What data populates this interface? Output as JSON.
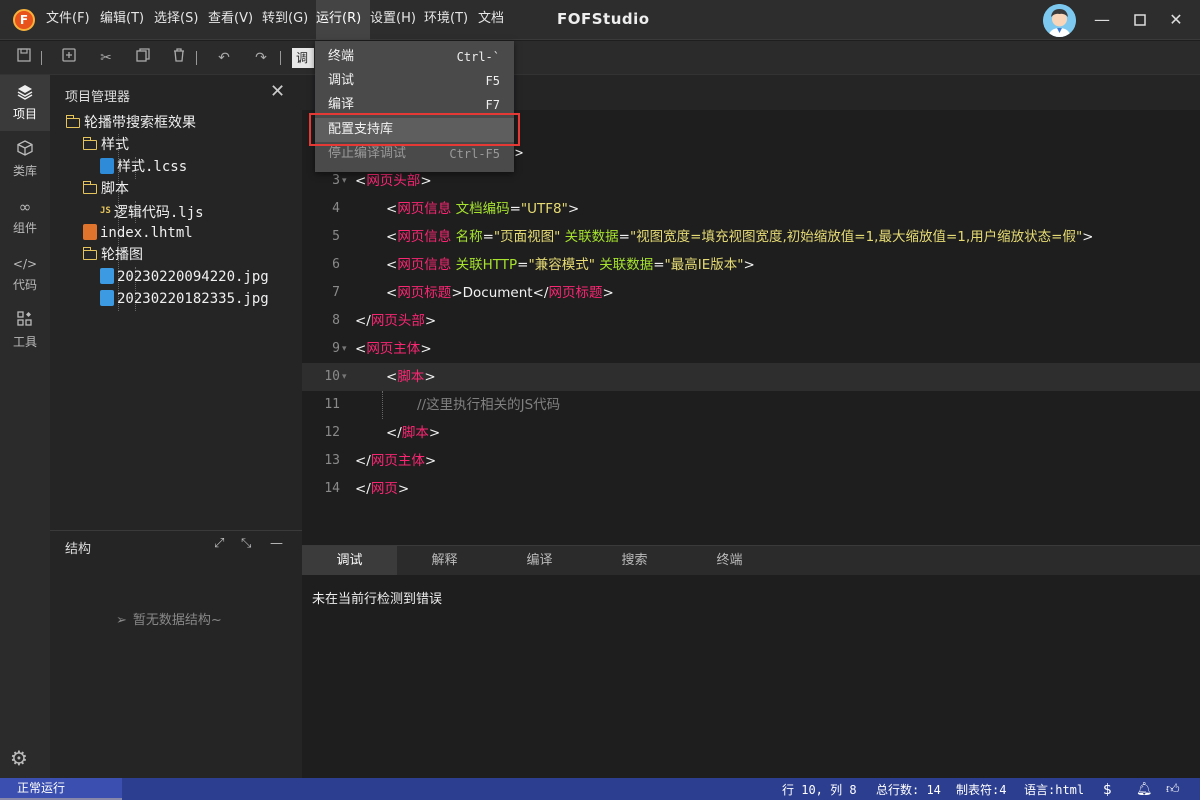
{
  "app": {
    "logo_letter": "F",
    "title": "FOFStudio"
  },
  "menu": [
    {
      "label": "文件(F)"
    },
    {
      "label": "编辑(T)"
    },
    {
      "label": "选择(S)"
    },
    {
      "label": "查看(V)"
    },
    {
      "label": "转到(G)"
    },
    {
      "label": "运行(R)"
    },
    {
      "label": "设置(H)"
    },
    {
      "label": "环境(T)"
    },
    {
      "label": "文档"
    }
  ],
  "toolbar": {
    "mode_label": "调"
  },
  "activity": [
    {
      "label": "项目",
      "icon": "layers-icon"
    },
    {
      "label": "类库",
      "icon": "cube-icon"
    },
    {
      "label": "组件",
      "icon": "link-icon"
    },
    {
      "label": "代码",
      "icon": "code-icon"
    },
    {
      "label": "工具",
      "icon": "tools-icon"
    }
  ],
  "explorer": {
    "title": "项目管理器",
    "tree": [
      {
        "label": "轮播带搜索框效果",
        "kind": "folder"
      },
      {
        "label": "样式",
        "kind": "folder"
      },
      {
        "label": "样式.lcss",
        "kind": "file-css"
      },
      {
        "label": "脚本",
        "kind": "folder"
      },
      {
        "label": "逻辑代码.ljs",
        "kind": "file-js",
        "badge": "JS"
      },
      {
        "label": "index.lhtml",
        "kind": "file-html"
      },
      {
        "label": "轮播图",
        "kind": "folder"
      },
      {
        "label": "20230220094220.jpg",
        "kind": "file-img"
      },
      {
        "label": "20230220182335.jpg",
        "kind": "file-img"
      }
    ]
  },
  "structure": {
    "title": "结构",
    "empty_text": "暂无数据结构~"
  },
  "editor": {
    "current_line": 10,
    "lines": [
      {
        "n": "3",
        "fold": true,
        "html": "<span class='pn'>&lt;</span><span class='tg'>网页头部</span><span class='pn'>&gt;</span>",
        "indent": 0
      },
      {
        "n": "4",
        "html": "<span class='pn'>&lt;</span><span class='tg'>网页信息</span> <span class='at'>文档编码</span>=<span class='st'>\"UTF8\"</span><span class='pn'>&gt;</span>",
        "indent": 1
      },
      {
        "n": "5",
        "html": "<span class='pn'>&lt;</span><span class='tg'>网页信息</span> <span class='at'>名称</span>=<span class='st'>\"页面视图\"</span> <span class='at'>关联数据</span>=<span class='st'>\"视图宽度=填充视图宽度,初始缩放值=1,最大缩放值=1,用户缩放状态=假\"</span><span class='pn'>&gt;</span>",
        "indent": 1
      },
      {
        "n": "6",
        "html": "<span class='pn'>&lt;</span><span class='tg'>网页信息</span> <span class='at'>关联HTTP</span>=<span class='st'>\"兼容模式\"</span> <span class='at'>关联数据</span>=<span class='st'>\"最高IE版本\"</span><span class='pn'>&gt;</span>",
        "indent": 1
      },
      {
        "n": "7",
        "html": "<span class='pn'>&lt;</span><span class='tg'>网页标题</span><span class='pn'>&gt;</span>Document<span class='pn'>&lt;/</span><span class='tg'>网页标题</span><span class='pn'>&gt;</span>",
        "indent": 1
      },
      {
        "n": "8",
        "html": "<span class='pn'>&lt;/</span><span class='tg'>网页头部</span><span class='pn'>&gt;</span>",
        "indent": 0
      },
      {
        "n": "9",
        "fold": true,
        "html": "<span class='pn'>&lt;</span><span class='tg'>网页主体</span><span class='pn'>&gt;</span>",
        "indent": 0
      },
      {
        "n": "10",
        "fold": true,
        "html": "<span class='pn'>&lt;</span><span class='tg'>脚本</span><span class='pn'>&gt;</span>",
        "indent": 1
      },
      {
        "n": "11",
        "html": "<span class='cm'>//这里执行相关的JS代码</span>",
        "indent": 2
      },
      {
        "n": "12",
        "html": "<span class='pn'>&lt;/</span><span class='tg'>脚本</span><span class='pn'>&gt;</span>",
        "indent": 1
      },
      {
        "n": "13",
        "html": "<span class='pn'>&lt;/</span><span class='tg'>网页主体</span><span class='pn'>&gt;</span>",
        "indent": 0
      },
      {
        "n": "14",
        "html": "<span class='pn'>&lt;/</span><span class='tg'>网页</span><span class='pn'>&gt;</span>",
        "indent": 0
      }
    ],
    "partial_line_tail": ">"
  },
  "run_menu": {
    "items": [
      {
        "label": "终端",
        "shortcut": "Ctrl-`"
      },
      {
        "label": "调试",
        "shortcut": "F5"
      },
      {
        "label": "编译",
        "shortcut": "F7"
      },
      {
        "label": "配置支持库",
        "shortcut": "",
        "state": "hover"
      },
      {
        "label": "停止编译调试",
        "shortcut": "Ctrl-F5",
        "state": "disabled"
      }
    ]
  },
  "panel": {
    "tabs": [
      {
        "label": "调试",
        "active": true
      },
      {
        "label": "解释"
      },
      {
        "label": "编译"
      },
      {
        "label": "搜索"
      },
      {
        "label": "终端"
      }
    ],
    "message": "未在当前行检测到错误"
  },
  "statusbar": {
    "mode": "正常运行",
    "position": "行 10, 列 8",
    "total_lines": "总行数: 14",
    "tab": "制表符:4",
    "language": "语言:html"
  },
  "colors": {
    "accent": "#2c3e8f",
    "highlight_box": "#e53935",
    "tag": "#f92672",
    "attr": "#a6e22e",
    "string": "#e6db74"
  }
}
